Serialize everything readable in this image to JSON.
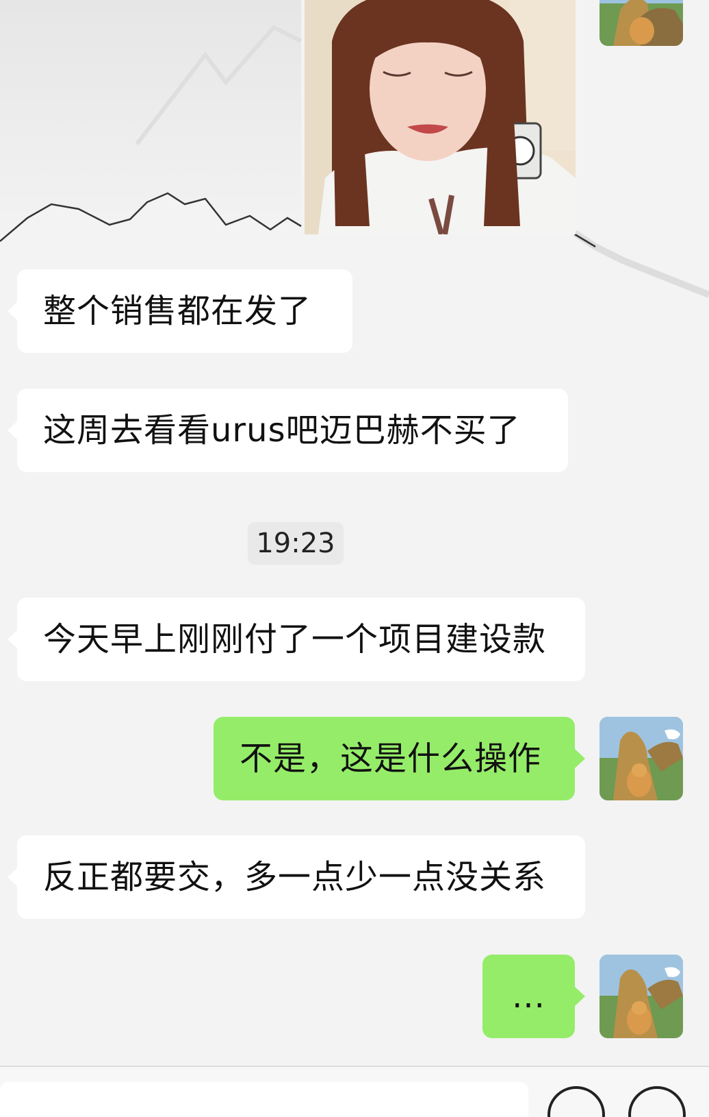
{
  "conversation": {
    "messages": [
      {
        "side": "in",
        "text": "整个销售都在发了"
      },
      {
        "side": "in",
        "text": "这周去看看urus吧迈巴赫不买了"
      },
      {
        "side": "in",
        "text": "今天早上刚刚付了一个项目建设款"
      },
      {
        "side": "out",
        "text": "不是，这是什么操作"
      },
      {
        "side": "in",
        "text": "反正都要交，多一点少一点没关系"
      },
      {
        "side": "out",
        "text": "..."
      }
    ],
    "timestamp": "19:23"
  },
  "icons": {
    "emoji_button": "emoji-icon",
    "more_button": "plus-icon"
  },
  "colors": {
    "background": "#f3f3f3",
    "incoming_bubble": "#ffffff",
    "outgoing_bubble": "#95ec69",
    "text": "#111111"
  }
}
